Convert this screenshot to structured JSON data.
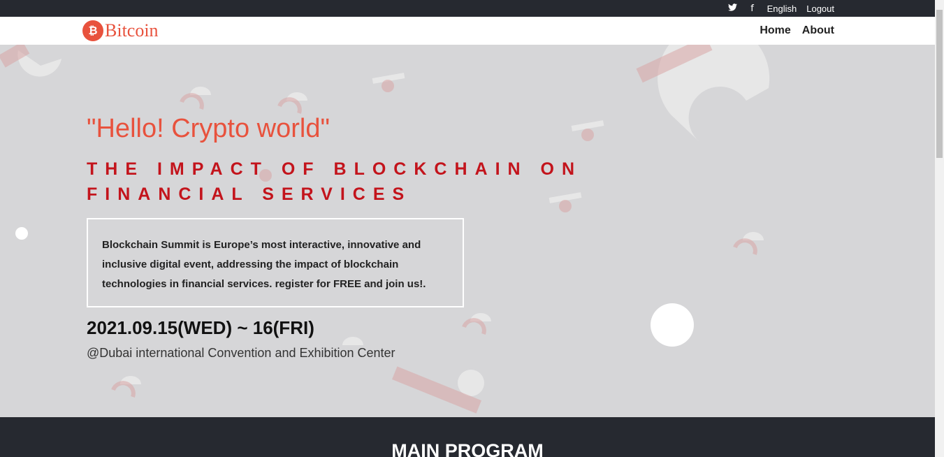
{
  "topbar": {
    "twitter_icon": "🐦",
    "facebook_icon": "f",
    "language": "English",
    "logout": "Logout"
  },
  "brand": {
    "mark": "₿",
    "name": "Bitcoin",
    "color": "#e8523d"
  },
  "nav": {
    "home": "Home",
    "about": "About"
  },
  "hero": {
    "greeting": "\"Hello! Crypto world\"",
    "tagline": "THE IMPACT OF BLOCKCHAIN ON FINANCIAL SERVICES",
    "description": "Blockchain Summit is Europe’s most interactive, innovative and inclusive digital event, addressing the impact of blockchain technologies in financial services. register for FREE and join us!.",
    "date": "2021.09.15(WED) ~ 16(FRI)",
    "venue": "@Dubai international Convention and Exhibition Center",
    "accent_color": "#c3141c"
  },
  "program": {
    "title": "MAIN PROGRAM"
  }
}
